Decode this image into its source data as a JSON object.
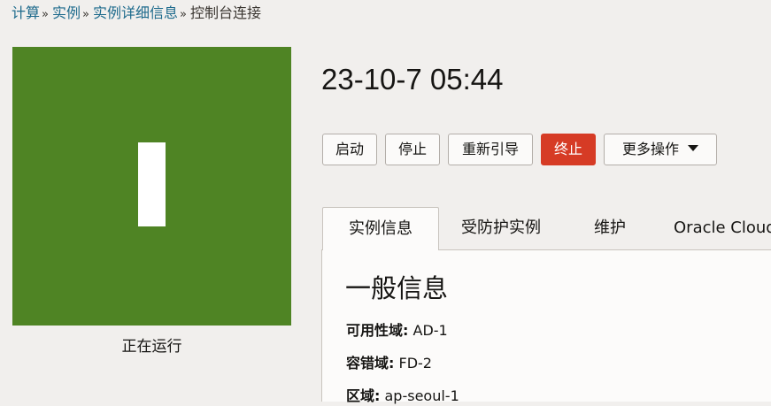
{
  "breadcrumb": {
    "items": [
      "计算",
      "实例",
      "实例详细信息"
    ],
    "separator": "»",
    "current": "控制台连接"
  },
  "instance": {
    "state": "正在运行",
    "status_color": "#4f8424",
    "icon": "instance-glyph-icon",
    "title": "23-10-7 05:44"
  },
  "actions": {
    "start": "启动",
    "stop": "停止",
    "reboot": "重新引导",
    "terminate": "终止",
    "more": "更多操作"
  },
  "tabs": [
    {
      "label": "实例信息",
      "active": true
    },
    {
      "label": "受防护实例",
      "active": false
    },
    {
      "label": "维护",
      "active": false
    },
    {
      "label": "Oracle Cloud",
      "active": false
    }
  ],
  "general": {
    "title": "一般信息",
    "fields": [
      {
        "label": "可用性域:",
        "value": "AD-1"
      },
      {
        "label": "容错域:",
        "value": "FD-2"
      },
      {
        "label": "区域:",
        "value": "ap-seoul-1"
      }
    ]
  }
}
